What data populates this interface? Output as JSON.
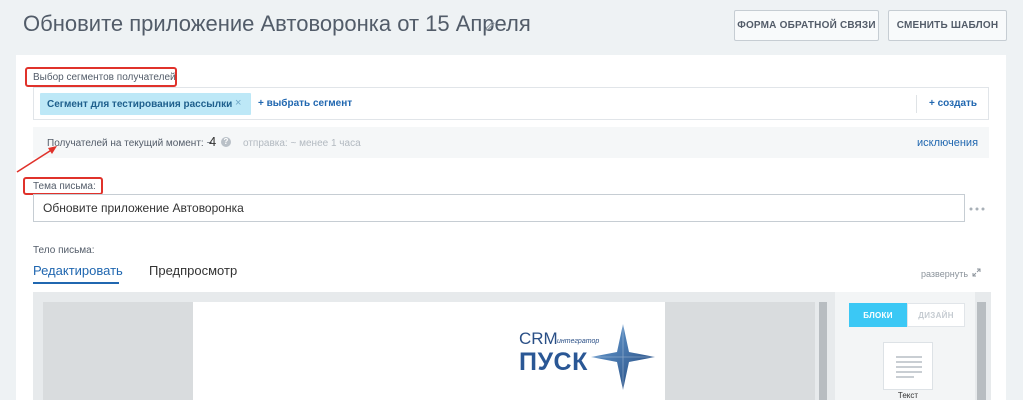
{
  "header": {
    "title": "Обновите приложение Автоворонка от 15 Апреля",
    "feedback_button": "Форма обратной связи",
    "change_template_button": "Сменить шаблон"
  },
  "segments": {
    "label": "Выбор сегментов получателей",
    "selected_tag": "Сегмент для тестирования рассылки",
    "remove_glyph": "×",
    "choose_link": "+ выбрать сегмент",
    "create_link": "+ создать"
  },
  "recipients": {
    "label": "Получателей на текущий момент: ~",
    "count": "4",
    "send_time": "отправка: ~ менее 1 часа",
    "exclusions_link": "исключения"
  },
  "subject": {
    "label": "Тема письма:",
    "value": "Обновите приложение Автоворонка"
  },
  "body": {
    "label": "Тело письма:",
    "tabs": [
      {
        "label": "Редактировать",
        "active": true
      },
      {
        "label": "Предпросмотр",
        "active": false
      }
    ],
    "expand_link": "развернуть"
  },
  "editor": {
    "mode_blocks": "Блоки",
    "mode_design": "Дизайн",
    "block_tile_caption": "Текст",
    "logo": {
      "crm": "CRM",
      "sub": "интегратор",
      "name": "ПУСК"
    }
  },
  "colors": {
    "accent": "#2067b0",
    "annotation": "#e0322b",
    "tag_bg": "#bde8f7",
    "mode_active": "#3bc8f5"
  },
  "icons": [
    "pencil-icon",
    "help-icon",
    "more-icon",
    "expand-icon",
    "text-block-icon",
    "logo-star-icon"
  ]
}
